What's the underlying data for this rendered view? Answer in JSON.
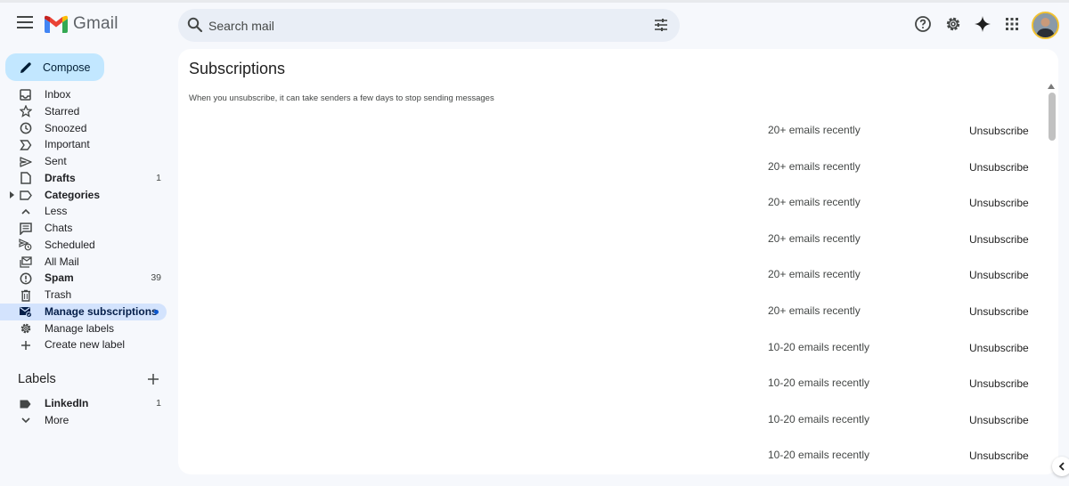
{
  "header": {
    "app_name": "Gmail",
    "search_placeholder": "Search mail"
  },
  "sidebar": {
    "compose_label": "Compose",
    "items": [
      {
        "label": "Inbox",
        "icon": "inbox-icon",
        "count": "",
        "bold": false
      },
      {
        "label": "Starred",
        "icon": "star-icon",
        "count": "",
        "bold": false
      },
      {
        "label": "Snoozed",
        "icon": "clock-icon",
        "count": "",
        "bold": false
      },
      {
        "label": "Important",
        "icon": "important-icon",
        "count": "",
        "bold": false
      },
      {
        "label": "Sent",
        "icon": "send-icon",
        "count": "",
        "bold": false
      },
      {
        "label": "Drafts",
        "icon": "draft-icon",
        "count": "1",
        "bold": true
      },
      {
        "label": "Categories",
        "icon": "label-icon",
        "count": "",
        "bold": true
      },
      {
        "label": "Less",
        "icon": "chevron-up-icon",
        "count": "",
        "bold": false
      },
      {
        "label": "Chats",
        "icon": "chat-icon",
        "count": "",
        "bold": false
      },
      {
        "label": "Scheduled",
        "icon": "scheduled-icon",
        "count": "",
        "bold": false
      },
      {
        "label": "All Mail",
        "icon": "all-mail-icon",
        "count": "",
        "bold": false
      },
      {
        "label": "Spam",
        "icon": "spam-icon",
        "count": "39",
        "bold": true
      },
      {
        "label": "Trash",
        "icon": "trash-icon",
        "count": "",
        "bold": false
      },
      {
        "label": "Manage subscriptions",
        "icon": "subscriptions-icon",
        "count": "",
        "bold": true
      },
      {
        "label": "Manage labels",
        "icon": "gear-icon",
        "count": "",
        "bold": false
      },
      {
        "label": "Create new label",
        "icon": "plus-icon",
        "count": "",
        "bold": false
      }
    ],
    "labels_heading": "Labels",
    "labels": [
      {
        "label": "LinkedIn",
        "count": "1",
        "bold": true
      },
      {
        "label": "More",
        "count": "",
        "bold": false
      }
    ]
  },
  "main": {
    "title": "Subscriptions",
    "subtitle": "When you unsubscribe, it can take senders a few days to stop sending messages",
    "rows": [
      {
        "count": "20+ emails recently",
        "action": "Unsubscribe"
      },
      {
        "count": "20+ emails recently",
        "action": "Unsubscribe"
      },
      {
        "count": "20+ emails recently",
        "action": "Unsubscribe"
      },
      {
        "count": "20+ emails recently",
        "action": "Unsubscribe"
      },
      {
        "count": "20+ emails recently",
        "action": "Unsubscribe"
      },
      {
        "count": "20+ emails recently",
        "action": "Unsubscribe"
      },
      {
        "count": "10-20 emails recently",
        "action": "Unsubscribe"
      },
      {
        "count": "10-20 emails recently",
        "action": "Unsubscribe"
      },
      {
        "count": "10-20 emails recently",
        "action": "Unsubscribe"
      },
      {
        "count": "10-20 emails recently",
        "action": "Unsubscribe"
      }
    ]
  },
  "colors": {
    "background": "#f6f8fc",
    "compose": "#c2e7ff",
    "active_nav": "#d3e3fd",
    "accent": "#0b57d0"
  }
}
